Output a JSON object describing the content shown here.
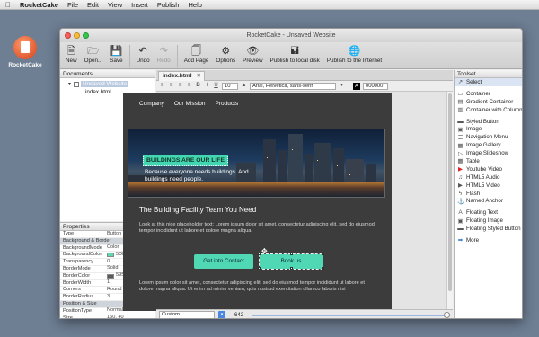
{
  "menubar": {
    "apple": "",
    "app": "RocketCake",
    "items": [
      "File",
      "Edit",
      "View",
      "Insert",
      "Publish",
      "Help"
    ]
  },
  "desktop": {
    "icon_label": "RocketCake"
  },
  "window": {
    "title": "RocketCake - Unsaved Website"
  },
  "toolbar": {
    "new": "New",
    "open": "Open...",
    "save": "Save",
    "undo": "Undo",
    "redo": "Redo",
    "add_page": "Add Page",
    "options": "Options",
    "preview": "Preview",
    "publish_local": "Publish to local disk",
    "publish_internet": "Publish to the Internet"
  },
  "documents": {
    "header": "Documents",
    "root": "Unsaved Website",
    "page": "index.html"
  },
  "properties": {
    "header": "Properties",
    "rows": [
      {
        "k": "Type",
        "v": "Button",
        "hd": false
      },
      {
        "k": "Background & Border",
        "v": "",
        "hd": true
      },
      {
        "k": "BackgroundMode",
        "v": "Color",
        "hd": false
      },
      {
        "k": "BackgroundColor",
        "v": "5DDAB2",
        "hd": false,
        "color": "#5DDAB2"
      },
      {
        "k": "Transparency",
        "v": "0",
        "hd": false
      },
      {
        "k": "BorderMode",
        "v": "Solid",
        "hd": false
      },
      {
        "k": "BorderColor",
        "v": "595959",
        "hd": false,
        "color": "#595959"
      },
      {
        "k": "BorderWidth",
        "v": "1",
        "hd": false
      },
      {
        "k": "Corners",
        "v": "Round",
        "hd": false
      },
      {
        "k": "BorderRadius",
        "v": "3",
        "hd": false
      },
      {
        "k": "Position & Size",
        "v": "",
        "hd": true
      },
      {
        "k": "PositionType",
        "v": "Normal",
        "hd": false
      },
      {
        "k": "Size",
        "v": "150, 40",
        "hd": false
      },
      {
        "k": "MinWidth",
        "v": "none",
        "hd": false
      }
    ]
  },
  "editor": {
    "tab": "index.html",
    "font": "Arial, Helvetica, sans-serif",
    "font_size": "10",
    "color_value": "000000",
    "nav": [
      "Company",
      "Our Mission",
      "Products"
    ],
    "hero_banner": "BUILDINGS ARE OUR LIFE",
    "hero_text": "Because everyone needs buildings. And buildings need people.",
    "title": "The Building Facility Team You Need",
    "body": "Look at this nice placeholder text: Lorem ipsum dolor sit amet, consectetur adipiscing elit, sed do eiusmod tempor incididunt ut labore et dolore magna aliqua.",
    "cta1": "Get into Contact",
    "cta2": "Book us",
    "body2": "Lorem ipsum dolor sit amet, consectetur adipiscing elit, sed do eiusmod tempor incididunt ut labore et dolore magna aliqua. Ut enim ad minim veniam, quis nostrud exercitation ullamco laboris nisi",
    "size_mode": "Custom",
    "width": "642"
  },
  "toolset": {
    "header": "Toolset",
    "groups": [
      [
        {
          "label": "Select",
          "icon": "cursor-icon"
        }
      ],
      [
        {
          "label": "Container",
          "icon": "container-icon"
        },
        {
          "label": "Gradient Container",
          "icon": "gradient-container-icon"
        },
        {
          "label": "Container with Column",
          "icon": "column-container-icon"
        }
      ],
      [
        {
          "label": "Styled Button",
          "icon": "button-icon"
        },
        {
          "label": "Image",
          "icon": "image-icon"
        },
        {
          "label": "Navigation Menu",
          "icon": "menu-icon"
        },
        {
          "label": "Image Gallery",
          "icon": "gallery-icon"
        },
        {
          "label": "Image Slideshow",
          "icon": "slideshow-icon"
        },
        {
          "label": "Table",
          "icon": "table-icon"
        },
        {
          "label": "Youtube Video",
          "icon": "youtube-icon"
        },
        {
          "label": "HTML5 Audio",
          "icon": "audio-icon"
        },
        {
          "label": "HTML5 Video",
          "icon": "video-icon"
        },
        {
          "label": "Flash",
          "icon": "flash-icon"
        },
        {
          "label": "Named Anchor",
          "icon": "anchor-icon"
        }
      ],
      [
        {
          "label": "Floating Text",
          "icon": "text-icon"
        },
        {
          "label": "Floating Image",
          "icon": "floating-image-icon"
        },
        {
          "label": "Floating Styled Button",
          "icon": "floating-button-icon"
        }
      ],
      [
        {
          "label": "More",
          "icon": "arrow-right-icon"
        }
      ]
    ]
  }
}
